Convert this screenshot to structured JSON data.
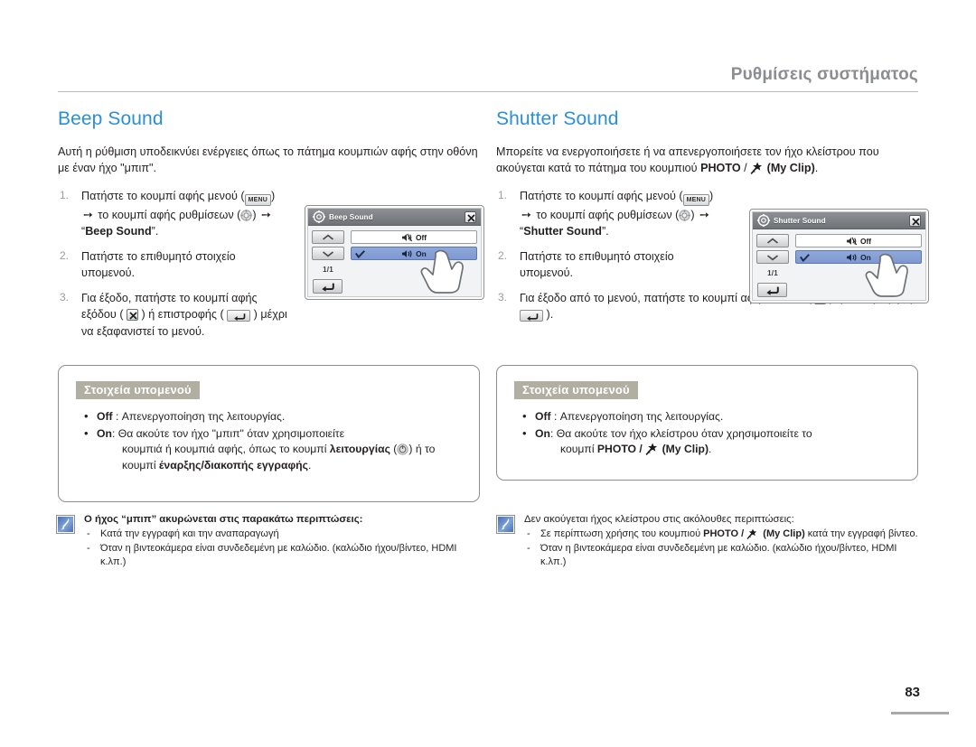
{
  "header": {
    "running_title": "Ρυθμίσεις συστήματος"
  },
  "page_number": "83",
  "left": {
    "heading": "Beep Sound",
    "intro": "Αυτή η ρύθμιση υποδεικνύει ενέργειες όπως το πάτημα κουμπιών αφής στην οθόνη με έναν ήχο \"μπιπ\".",
    "steps": [
      {
        "num": "1.",
        "pre": "Πατήστε το κουμπί αφής μενού (",
        "key": "MENU",
        "mid": ") ",
        "arrow": "➙",
        "mid2": " το κουμπί αφής ρυθμίσεων (",
        "gear": "gear-icon",
        "mid3": ") ",
        "arrow2": "➙",
        "quote_open": " “",
        "bold": "Beep Sound",
        "quote_close": "”."
      },
      {
        "num": "2.",
        "text": "Πατήστε το επιθυμητό στοιχείο υπομενού."
      },
      {
        "num": "3.",
        "pre": "Για έξοδο, πατήστε το κουμπί αφής εξόδου ( ",
        "x": "exit-icon",
        "mid": " ) ή επιστροφής ( ",
        "ret": "return-icon",
        "post": " ) μέχρι να εξαφανιστεί το μενού."
      }
    ],
    "lcd": {
      "title": "Beep Sound",
      "page_indicator": "1/1",
      "rows": [
        {
          "label": "Off",
          "selected": false
        },
        {
          "label": "On",
          "selected": true
        }
      ]
    },
    "submenu": {
      "heading": "Στοιχεία υπομενού",
      "items": [
        {
          "term": "Off",
          "sep": " : ",
          "text": "Απενεργοποίηση της λειτουργίας."
        },
        {
          "term": "On",
          "sep": ": ",
          "text": "Θα ακούτε τον ήχο \"μπιπ\" όταν χρησιμοποιείτε",
          "line2_pre": "κουμπιά ή κουμπιά αφής, όπως το κουμπί ",
          "line2_b1": "λειτουργίας",
          "line2_mid": " (",
          "line2_icon": "power-icon",
          "line2_mid2": ") ή το κουμπί ",
          "line2_b2": "έναρξης/διακοπής εγγραφής",
          "line2_end": "."
        }
      ]
    },
    "note": {
      "title": "Ο ήχος “μπιπ” ακυρώνεται στις παρακάτω περιπτώσεις:",
      "bold_title": true,
      "items": [
        "Κατά την εγγραφή και την αναπαραγωγή",
        "Όταν η βιντεοκάμερα είναι συνδεδεμένη με καλώδιο. (καλώδιο ήχου/βίντεο, HDMI κ.λπ.)"
      ]
    }
  },
  "right": {
    "heading": "Shutter Sound",
    "intro_pre": "Μπορείτε να ενεργοποιήσετε ή να απενεργοποιήσετε τον ήχο κλείστρου που ακούγεται κατά το πάτημα του κουμπιού ",
    "intro_b1": "PHOTO",
    "intro_slash": " / ",
    "intro_icon": "my-clip-icon",
    "intro_b2": " (My Clip)",
    "intro_end": ".",
    "steps": [
      {
        "num": "1.",
        "pre": "Πατήστε το κουμπί αφής μενού (",
        "key": "MENU",
        "mid": ") ",
        "arrow": "➙",
        "mid2": " το κουμπί αφής ρυθμίσεων (",
        "gear": "gear-icon",
        "mid3": ") ",
        "arrow2": "➙",
        "quote_open": " “",
        "bold": "Shutter Sound",
        "quote_close": "”."
      },
      {
        "num": "2.",
        "text": "Πατήστε το επιθυμητό στοιχείο υπομενού."
      },
      {
        "num": "3.",
        "pre": "Για έξοδο από το μενού, πατήστε το κουμπί αφής εξόδου ( ",
        "x": "exit-icon",
        "mid": " ) ή επιστροφής ( ",
        "ret": "return-icon",
        "post": " )."
      }
    ],
    "lcd": {
      "title": "Shutter Sound",
      "page_indicator": "1/1",
      "rows": [
        {
          "label": "Off",
          "selected": false
        },
        {
          "label": "On",
          "selected": true
        }
      ]
    },
    "submenu": {
      "heading": "Στοιχεία υπομενού",
      "items": [
        {
          "term": "Off",
          "sep": " : ",
          "text": "Απενεργοποίηση της λειτουργίας."
        },
        {
          "term": "On",
          "sep": ": ",
          "text": "Θα ακούτε τον ήχο κλείστρου όταν χρησιμοποιείτε το",
          "line2_pre": "κουμπί ",
          "line2_b1": "PHOTO / ",
          "line2_icon": "my-clip-icon",
          "line2_b2": " (My Clip)",
          "line2_end": "."
        }
      ]
    },
    "note": {
      "title": "Δεν ακούγεται ήχος κλείστρου στις ακόλουθες περιπτώσεις:",
      "bold_title": false,
      "item1_pre": "Σε περίπτωση χρήσης του κουμπιού ",
      "item1_b1": "PHOTO / ",
      "item1_icon": "my-clip-icon",
      "item1_b2": " (My Clip)",
      "item1_end": " κατά την εγγραφή βίντεο.",
      "item2": "Όταν η βιντεοκάμερα είναι συνδεδεμένη με καλώδιο. (καλώδιο ήχου/βίντεο, HDMI κ.λπ.)"
    }
  },
  "colors": {
    "heading_blue": "#2b8fd4",
    "running_head_gray": "#8b8d90",
    "submenu_tag_bg": "#b1aea2",
    "lcd_selected_row": "#85a0d6"
  }
}
